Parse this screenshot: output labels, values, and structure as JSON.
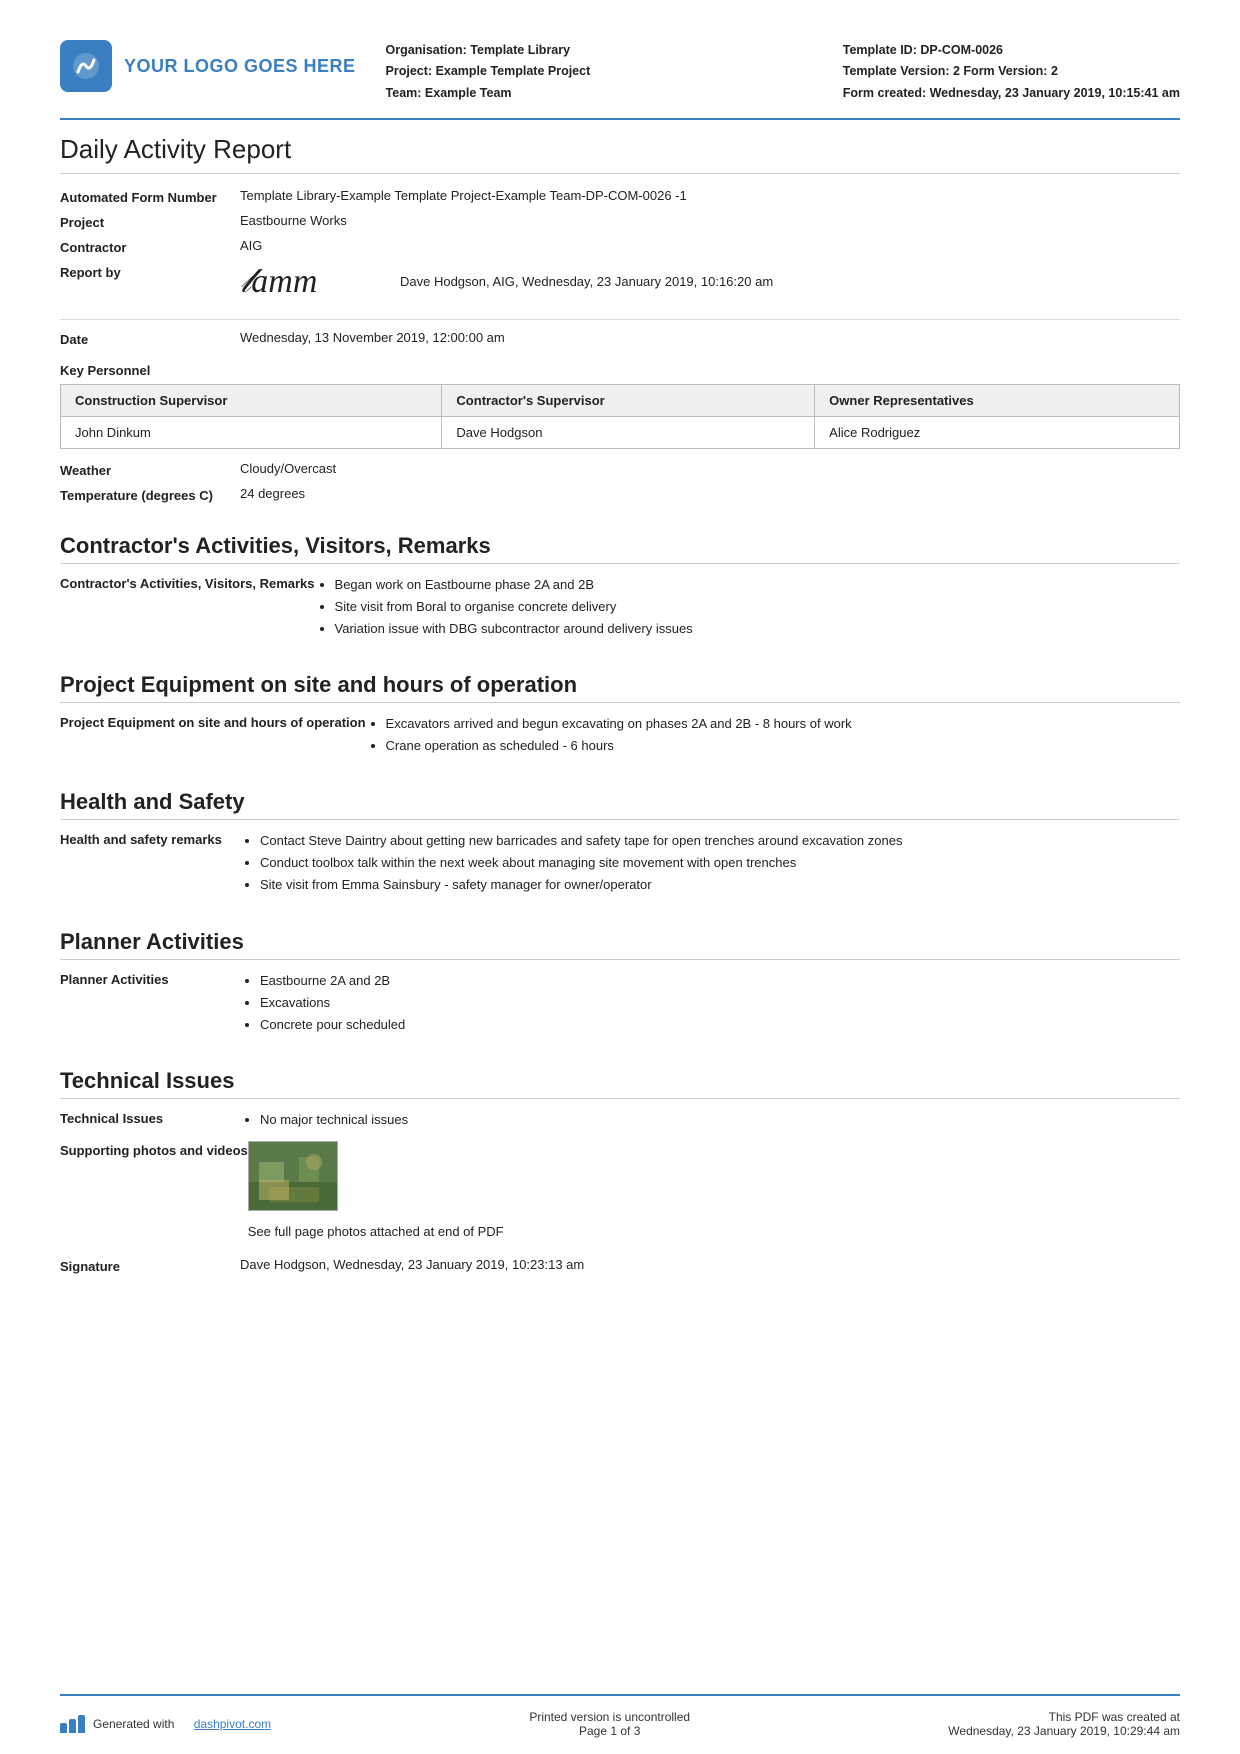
{
  "header": {
    "logo_text": "YOUR LOGO GOES HERE",
    "org_label": "Organisation:",
    "org_value": "Template Library",
    "project_label": "Project:",
    "project_value": "Example Template Project",
    "team_label": "Team:",
    "team_value": "Example Team",
    "template_id_label": "Template ID:",
    "template_id_value": "DP-COM-0026",
    "template_version_label": "Template Version:",
    "template_version_value": "2 Form Version: 2",
    "form_created_label": "Form created:",
    "form_created_value": "Wednesday, 23 January 2019, 10:15:41 am"
  },
  "report": {
    "title": "Daily Activity Report",
    "form_number_label": "Automated Form Number",
    "form_number_value": "Template Library-Example Template Project-Example Team-DP-COM-0026   -1",
    "project_label": "Project",
    "project_value": "Eastbourne Works",
    "contractor_label": "Contractor",
    "contractor_value": "AIG",
    "report_by_label": "Report by",
    "report_by_text": "Dave Hodgson, AIG, Wednesday, 23 January 2019, 10:16:20 am",
    "date_label": "Date",
    "date_value": "Wednesday, 13 November 2019, 12:00:00 am"
  },
  "key_personnel": {
    "section_label": "Key Personnel",
    "columns": [
      "Construction Supervisor",
      "Contractor's Supervisor",
      "Owner Representatives"
    ],
    "rows": [
      [
        "John Dinkum",
        "Dave Hodgson",
        "Alice Rodriguez"
      ]
    ]
  },
  "weather": {
    "label": "Weather",
    "value": "Cloudy/Overcast",
    "temp_label": "Temperature (degrees C)",
    "temp_value": "24 degrees"
  },
  "contractors_activities": {
    "heading": "Contractor's Activities, Visitors, Remarks",
    "field_label": "Contractor's Activities, Visitors, Remarks",
    "items": [
      "Began work on Eastbourne phase 2A and 2B",
      "Site visit from Boral to organise concrete delivery",
      "Variation issue with DBG subcontractor around delivery issues"
    ]
  },
  "project_equipment": {
    "heading": "Project Equipment on site and hours of operation",
    "field_label": "Project Equipment on site and hours of operation",
    "items": [
      "Excavators arrived and begun excavating on phases 2A and 2B - 8 hours of work",
      "Crane operation as scheduled - 6 hours"
    ]
  },
  "health_safety": {
    "heading": "Health and Safety",
    "field_label": "Health and safety remarks",
    "items": [
      "Contact Steve Daintry about getting new barricades and safety tape for open trenches around excavation zones",
      "Conduct toolbox talk within the next week about managing site movement with open trenches",
      "Site visit from Emma Sainsbury - safety manager for owner/operator"
    ]
  },
  "planner_activities": {
    "heading": "Planner Activities",
    "field_label": "Planner Activities",
    "items": [
      "Eastbourne 2A and 2B",
      "Excavations",
      "Concrete pour scheduled"
    ]
  },
  "technical_issues": {
    "heading": "Technical Issues",
    "field_label": "Technical Issues",
    "items": [
      "No major technical issues"
    ],
    "photos_label": "Supporting photos and videos",
    "photos_caption": "See full page photos attached at end of PDF",
    "signature_label": "Signature",
    "signature_value": "Dave Hodgson, Wednesday, 23 January 2019, 10:23:13 am"
  },
  "footer": {
    "generated_text": "Generated with",
    "link_text": "dashpivot.com",
    "center_text": "Printed version is uncontrolled",
    "page_text": "Page 1 of 3",
    "right_text": "This PDF was created at",
    "right_date": "Wednesday, 23 January 2019, 10:29:44 am"
  }
}
